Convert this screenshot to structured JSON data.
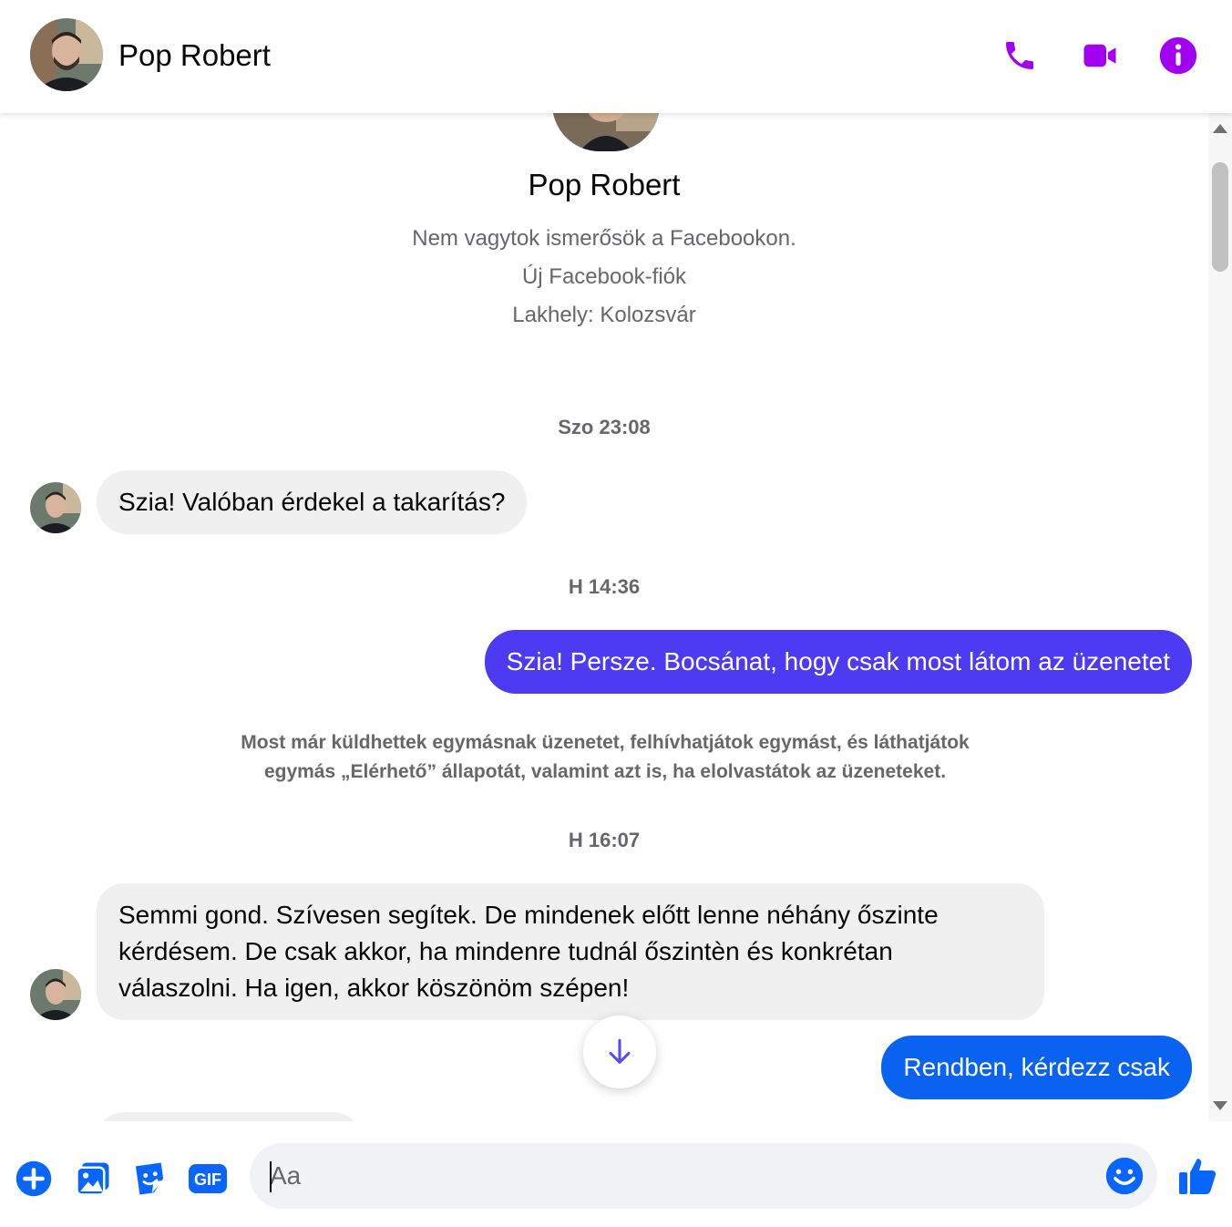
{
  "header": {
    "contact_name": "Pop Robert"
  },
  "profile": {
    "name": "Pop Robert",
    "line1": "Nem vagytok ismerősök a Facebookon.",
    "line2": "Új Facebook-fiók",
    "line3": "Lakhely: Kolozsvár"
  },
  "messages": {
    "ts1": "Szo 23:08",
    "m1": "Szia! Valóban érdekel a takarítás?",
    "ts2": "H 14:36",
    "m2": "Szia! Persze. Bocsánat, hogy csak most látom az üzenetet",
    "notice_line1": "Most már küldhettek egymásnak üzenetet, felhívhatjátok egymást, és láthatjátok",
    "notice_line2": "egymás „Elérhető” állapotát, valamint azt is, ha elolvastátok az üzeneteket.",
    "ts3": "H 16:07",
    "m3_line1": "Semmi gond. Szívesen segítek. De mindenek előtt lenne néhány őszinte",
    "m3_line2": "kérdésem. De csak akkor, ha mindenre tudnál őszintèn és konkrétan",
    "m3_line3": "válaszolni. Ha igen, akkor köszönöm szépen!",
    "m4": "Rendben, kérdezz csak"
  },
  "composer": {
    "placeholder": "Aa",
    "gif_label": "GIF"
  },
  "colors": {
    "accent": "#a200f0",
    "outgoing_purple": "#4c3bf2",
    "outgoing_blue": "#0a63f0",
    "composer_blue": "#0866ff"
  }
}
